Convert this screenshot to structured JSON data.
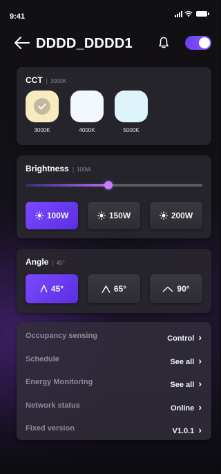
{
  "status_bar": {
    "time": "9:41"
  },
  "header": {
    "title": "DDDD_DDDD1"
  },
  "cct": {
    "label": "CCT",
    "value": "3000K",
    "options": [
      {
        "label": "3000K",
        "color": "#f7ecc0",
        "selected": true
      },
      {
        "label": "4000K",
        "color": "#f1f7fb",
        "selected": false
      },
      {
        "label": "5000K",
        "color": "#def4fb",
        "selected": false
      }
    ]
  },
  "brightness": {
    "label": "Brightness",
    "value": "100W",
    "slider_level": 0.47,
    "options": [
      {
        "label": "100W",
        "selected": true
      },
      {
        "label": "150W",
        "selected": false
      },
      {
        "label": "200W",
        "selected": false
      }
    ]
  },
  "angle": {
    "label": "Angle",
    "value": "45°",
    "options": [
      {
        "label": "45°",
        "selected": true
      },
      {
        "label": "65°",
        "selected": false
      },
      {
        "label": "90°",
        "selected": false
      }
    ]
  },
  "settings": [
    {
      "label": "Occupancy sensing",
      "value": "Control"
    },
    {
      "label": "Schedule",
      "value": "See all"
    },
    {
      "label": "Energy Monitoring",
      "value": "See all"
    },
    {
      "label": "Network status",
      "value": "Online"
    },
    {
      "label": "Fixed version",
      "value": "V1.0.1"
    }
  ],
  "colors": {
    "accent": "#7b49ff",
    "slider": "#c57cff"
  }
}
